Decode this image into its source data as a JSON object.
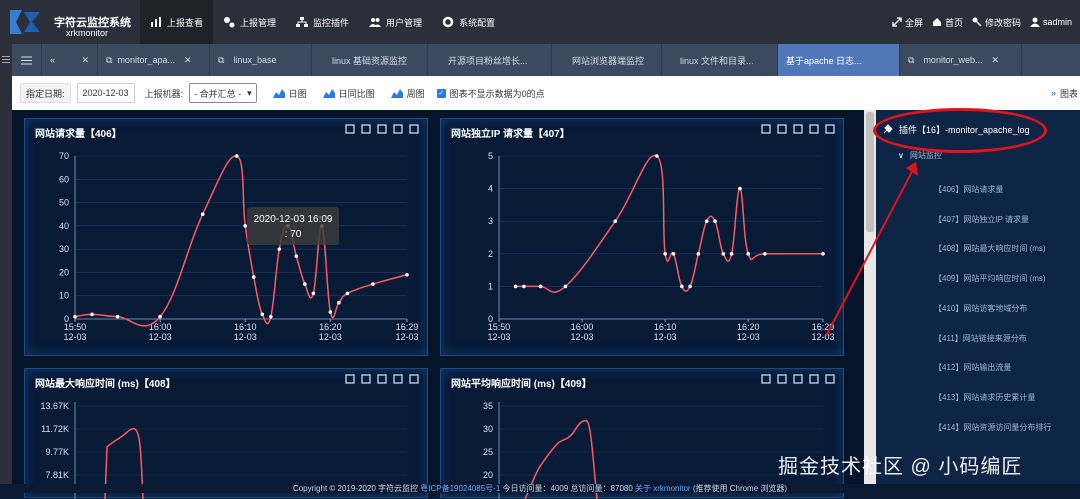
{
  "brand": {
    "name": "字符云监控系统",
    "sub": "xrkmonitor"
  },
  "nav": [
    "上报查看",
    "上报管理",
    "监控插件",
    "用户管理",
    "系统配置"
  ],
  "topright": {
    "fullscreen": "全屏",
    "home": "首页",
    "password": "修改密码",
    "user": "sadmin"
  },
  "tabs": [
    "monitor_apa...",
    "linux_base",
    "linux 基础资源监控",
    "开源项目粉丝增长...",
    "网站浏览器端监控",
    "linux 文件和目录...",
    "基于apache 日志...",
    "monitor_web..."
  ],
  "toolbar": {
    "date_label": "指定日期:",
    "date_value": "2020-12-03",
    "machine_label": "上报机器:",
    "machine_value": "- 合并汇总 -",
    "day": "日图",
    "daycomp": "日同比图",
    "week": "周图",
    "hide_zero": "图表不显示数据为0的点",
    "end": "图表"
  },
  "panels": [
    {
      "title": "网站请求量【406】"
    },
    {
      "title": "网站独立IP 请求量【407】"
    },
    {
      "title": "网站最大响应时间 (ms)【408】"
    },
    {
      "title": "网站平均响应时间 (ms)【409】"
    }
  ],
  "tooltip": {
    "time": "2020-12-03 16:09",
    "value": ": 70"
  },
  "chart_data": [
    {
      "type": "line",
      "title": "网站请求量【406】",
      "x": [
        "15:50",
        "15:52",
        "15:55",
        "16:00",
        "16:05",
        "16:09",
        "16:10",
        "16:11",
        "16:12",
        "16:13",
        "16:14",
        "16:15",
        "16:16",
        "16:17",
        "16:18",
        "16:19",
        "16:20",
        "16:21",
        "16:22",
        "16:25",
        "16:29"
      ],
      "values": [
        1,
        2,
        1,
        1,
        45,
        70,
        40,
        18,
        2,
        1,
        30,
        40,
        27,
        15,
        11,
        40,
        3,
        7,
        11,
        15,
        19
      ],
      "ylim": [
        0,
        70
      ],
      "yticks": [
        0,
        10,
        20,
        30,
        40,
        50,
        60,
        70
      ],
      "xticks": [
        "15:50\n12-03",
        "16:00\n12-03",
        "16:10\n12-03",
        "16:20\n12-03",
        "16:29\n12-03"
      ]
    },
    {
      "type": "line",
      "title": "网站独立IP 请求量【407】",
      "x": [
        "15:52",
        "15:53",
        "15:55",
        "15:58",
        "16:04",
        "16:09",
        "16:10",
        "16:11",
        "16:12",
        "16:13",
        "16:14",
        "16:15",
        "16:16",
        "16:17",
        "16:18",
        "16:19",
        "16:20",
        "16:22",
        "16:29"
      ],
      "values": [
        1,
        1,
        1,
        1,
        3,
        5,
        2,
        2,
        1,
        1,
        2,
        3,
        3,
        2,
        2,
        4,
        2,
        2,
        2
      ],
      "ylim": [
        0,
        5
      ],
      "yticks": [
        0,
        1,
        2,
        3,
        4,
        5
      ],
      "xticks": [
        "15:50\n12-03",
        "16:00\n12-03",
        "16:10\n12-03",
        "16:20\n12-03",
        "16:29\n12-03"
      ]
    },
    {
      "type": "line",
      "title": "网站最大响应时间 (ms)【408】",
      "yticks": [
        "13.67K",
        "11.72K",
        "9.77K",
        "7.81K"
      ]
    },
    {
      "type": "line",
      "title": "网站平均响应时间 (ms)【409】",
      "yticks": [
        35,
        30,
        25,
        20
      ]
    }
  ],
  "tree": {
    "root": "插件【16】-monitor_apache_log",
    "group": "网站监控",
    "items": [
      "【406】网站请求量",
      "【407】网站独立IP 请求量",
      "【408】网站最大响应时间 (ms)",
      "【409】网站平均响应时间 (ms)",
      "【410】网站访客地域分布",
      "【411】网站链接来源分布",
      "【412】网站输出流量",
      "【413】网站请求历史累计量",
      "【414】网站资源访问量分布排行"
    ]
  },
  "footer": {
    "copyright": "Copyright © 2019-2020 字符云监控",
    "icp": "粤ICP备19024085号-1",
    "today": "今日访问量：4009",
    "total": "总访问量：87080",
    "about": "关于 xrkmonitor",
    "rec": "(推荐使用 Chrome 浏览器)"
  },
  "watermark": "掘金技术社区 @ 小码编匠",
  "colors": {
    "line": "#ff5a5f",
    "accent": "#5077b8",
    "panel_border": "#1d4a82"
  }
}
